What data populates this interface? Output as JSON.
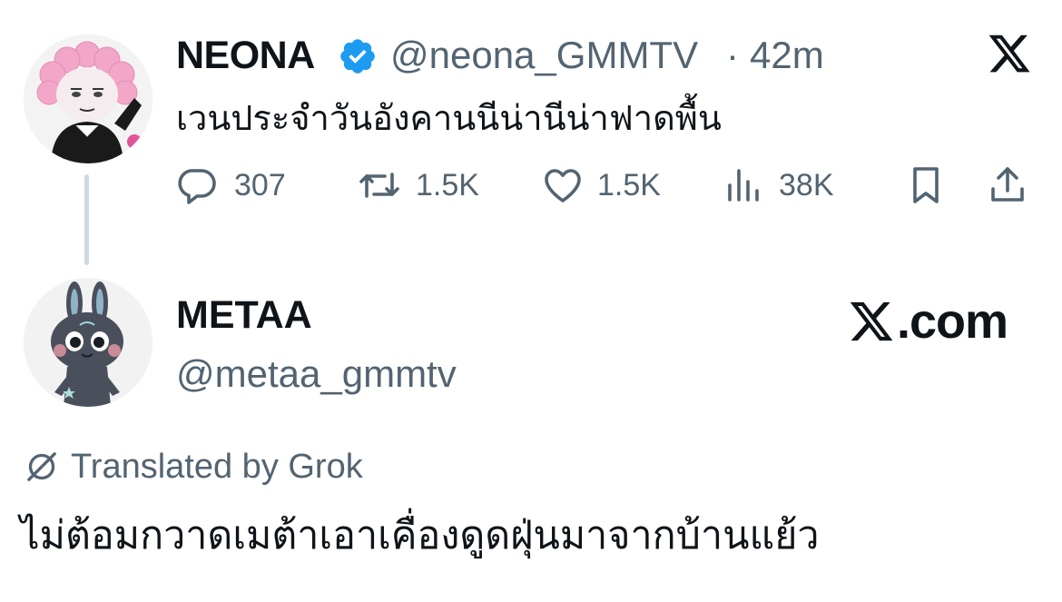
{
  "tweet": {
    "author_name": "NEONA",
    "verified": true,
    "handle": "@neona_GMMTV",
    "separator": "·",
    "time": "42m",
    "text": "เวนประจำวันอังคานนีน่านีน่าฟาดพื้น",
    "actions": {
      "replies": "307",
      "retweets": "1.5K",
      "likes": "1.5K",
      "views": "38K"
    },
    "platform_icon": "x-logo-icon"
  },
  "reply_card": {
    "author_name": "METAA",
    "handle": "@metaa_gmmtv",
    "brand_text": ".com",
    "brand_icon": "x-logo-icon"
  },
  "translation": {
    "label": "Translated by Grok",
    "text": "ไม่ต้อมกวาดเมต้าเอาเคื่องดูดฝุ่นมาจากบ้านแย้ว",
    "icon": "grok-icon"
  },
  "colors": {
    "text_primary": "#0f1419",
    "text_secondary": "#536471",
    "verified_blue": "#1d9bf0",
    "thread_line": "#cfd9de"
  }
}
